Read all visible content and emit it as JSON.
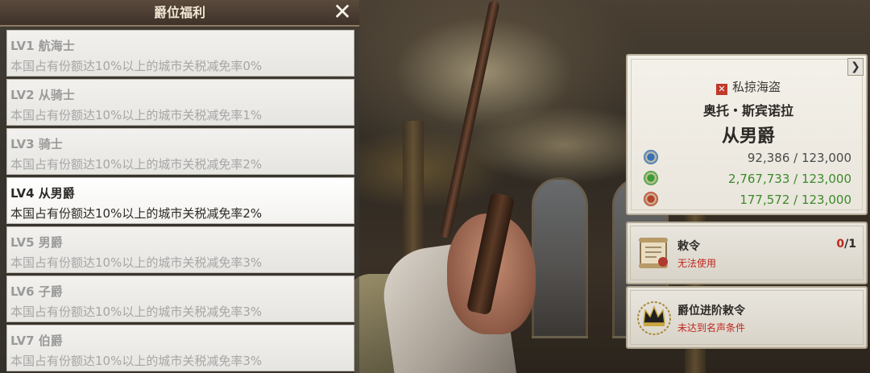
{
  "panel": {
    "title": "爵位福利",
    "close_label": "✕"
  },
  "levels": [
    {
      "lv": "LV1 航海士",
      "desc": "本国占有份额达10%以上的城市关税减免率0%",
      "active": false
    },
    {
      "lv": "LV2 从骑士",
      "desc": "本国占有份额达10%以上的城市关税减免率1%",
      "active": false
    },
    {
      "lv": "LV3 骑士",
      "desc": "本国占有份额达10%以上的城市关税减免率2%",
      "active": false
    },
    {
      "lv": "LV4 从男爵",
      "desc": "本国占有份额达10%以上的城市关税减免率2%",
      "active": true
    },
    {
      "lv": "LV5 男爵",
      "desc": "本国占有份额达10%以上的城市关税减免率3%",
      "active": false
    },
    {
      "lv": "LV6 子爵",
      "desc": "本国占有份额达10%以上的城市关税减免率3%",
      "active": false
    },
    {
      "lv": "LV7 伯爵",
      "desc": "本国占有份额达10%以上的城市关税减免率3%",
      "active": false
    }
  ],
  "profile": {
    "arrow": "❯",
    "faction": "私掠海盗",
    "name": "奥托・斯宾诺拉",
    "rank": "从男爵",
    "stats": [
      {
        "icon": "blue-laurel-medal-icon",
        "value": "92,386 / 123,000",
        "color": "#4a4a4a",
        "medal_color": "#3a6fb5"
      },
      {
        "icon": "green-laurel-medal-icon",
        "value": "2,767,733 / 123,000",
        "color": "#3c8a2a",
        "medal_color": "#3f9a3a"
      },
      {
        "icon": "red-laurel-medal-icon",
        "value": "177,572 / 123,000",
        "color": "#3c8a2a",
        "medal_color": "#b5432e"
      }
    ]
  },
  "edict": {
    "title": "敕令",
    "status": "无法使用",
    "count_current": "0",
    "count_total": "/1",
    "icon": "scroll-icon"
  },
  "promotion": {
    "title": "爵位进阶敕令",
    "status": "未达到名声条件",
    "icon": "crown-icon"
  }
}
